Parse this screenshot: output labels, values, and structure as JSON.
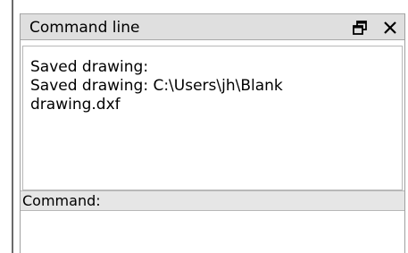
{
  "panel": {
    "title": "Command line",
    "float_icon": "float-window-icon",
    "close_icon": "close-icon"
  },
  "history": {
    "lines": [
      "Saved drawing:",
      "Saved drawing: C:\\Users\\jh\\Blank",
      "drawing.dxf"
    ]
  },
  "command": {
    "label": "Command:",
    "value": ""
  }
}
